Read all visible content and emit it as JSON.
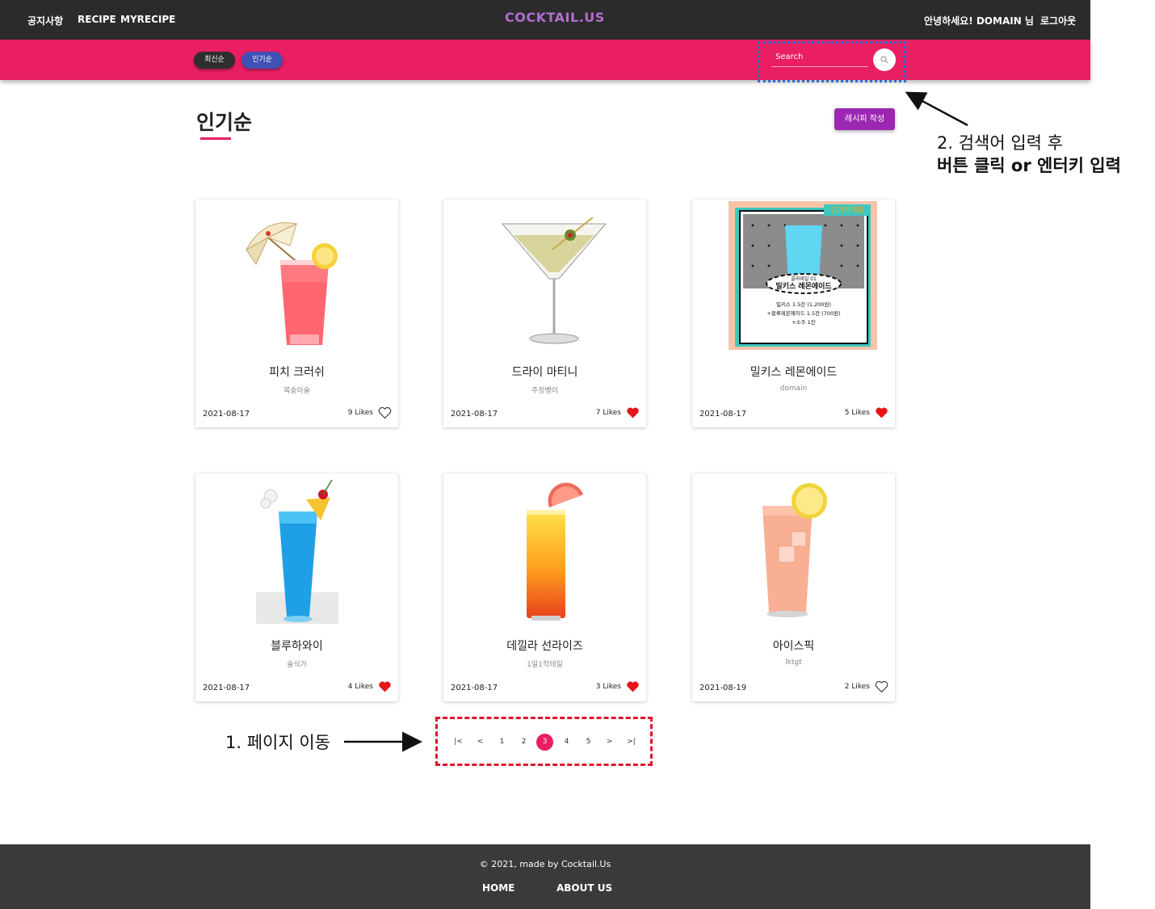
{
  "nav": {
    "notice": "공지사항",
    "recipe": "RECIPE",
    "myrecipe": "MYRECIPE",
    "logo": "COCKTAIL.US",
    "greeting": "안녕하세요! DOMAIN 님",
    "logout": "로그아웃"
  },
  "sort": {
    "latest": "최신순",
    "popular": "인기순"
  },
  "search": {
    "placeholder": "Search"
  },
  "page": {
    "title": "인기순",
    "write_button": "레시피 작성"
  },
  "cards": [
    {
      "name": "피치 크러쉬",
      "author": "복숭아술",
      "date": "2021-08-17",
      "likes": "9 Likes",
      "liked": false,
      "drink": "peach"
    },
    {
      "name": "드라이 마티니",
      "author": "주정뱅이",
      "date": "2021-08-17",
      "likes": "7 Likes",
      "liked": true,
      "drink": "martini"
    },
    {
      "name": "밀키스 레몬에이드",
      "author": "domain",
      "date": "2021-08-17",
      "likes": "5 Likes",
      "liked": true,
      "drink": "poster"
    },
    {
      "name": "블루하와이",
      "author": "술식가",
      "date": "2021-08-17",
      "likes": "4 Likes",
      "liked": true,
      "drink": "blue"
    },
    {
      "name": "데낄라 선라이즈",
      "author": "1일1칵테일",
      "date": "2021-08-17",
      "likes": "3 Likes",
      "liked": true,
      "drink": "sunrise"
    },
    {
      "name": "아이스픽",
      "author": "lktgt",
      "date": "2021-08-19",
      "likes": "2 Likes",
      "liked": false,
      "drink": "icepick"
    }
  ],
  "poster": {
    "badge": "인기칵테일",
    "subtitle": "콜라테일 01",
    "title": "밀키스 레몬에이드",
    "line1": "밀키스 1.5잔 (1,200원)",
    "line2": "+블루레몬에이드 1.5잔 (700원)",
    "line3": "+소주 1잔"
  },
  "pagination": {
    "first": "|<",
    "prev": "<",
    "pages": [
      "1",
      "2",
      "3",
      "4",
      "5"
    ],
    "current": "3",
    "next": ">",
    "last": ">|"
  },
  "annotations": {
    "search_line1": "2. 검색어 입력 후",
    "search_line2": "버튼 클릭 or 엔터키 입력",
    "pagination": "1. 페이지 이동"
  },
  "footer": {
    "copyright": "© 2021, made by Cocktail.Us",
    "home": "HOME",
    "about": "ABOUT US"
  },
  "colors": {
    "nav_bg": "#2b2b2b",
    "accent_pink": "#e91e63",
    "logo_purple": "#b26dcf",
    "write_purple": "#9c27b0",
    "popular_indigo": "#3f51b5",
    "heart_red": "#e8141a",
    "highlight_blue": "#2d6ed1",
    "highlight_red": "#e0142a",
    "footer_bg": "#3a3a3b"
  },
  "icons": {
    "search": "search-icon",
    "heart_filled": "heart-filled-icon",
    "heart_outline": "heart-outline-icon"
  }
}
